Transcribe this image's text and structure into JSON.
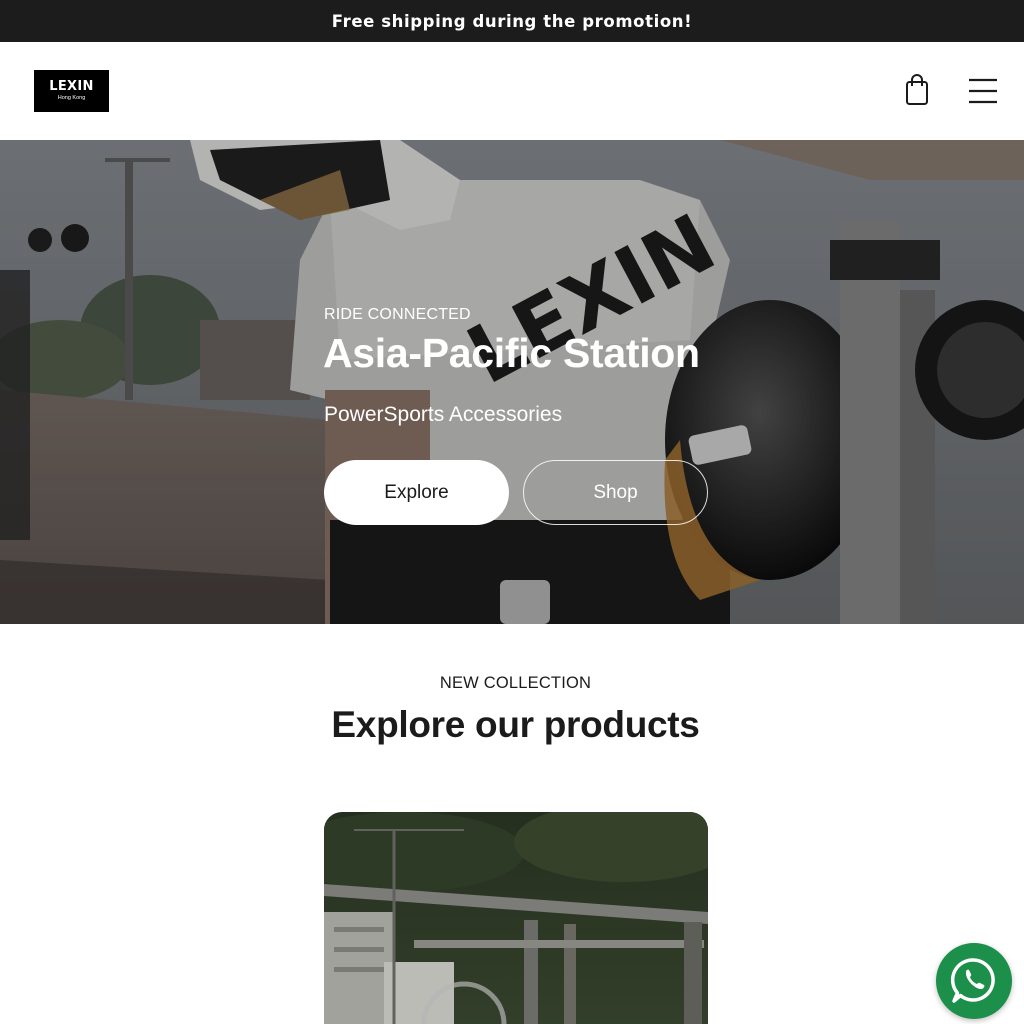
{
  "announcement": {
    "text": "Free shipping during the promotion!"
  },
  "header": {
    "logo": {
      "name": "LEXIN",
      "location": "Hong Kong"
    },
    "icons": {
      "cart": "shopping-bag-icon",
      "menu": "hamburger-menu-icon"
    }
  },
  "hero": {
    "eyebrow": "RIDE CONNECTED",
    "title": "Asia-Pacific Station",
    "subtitle": "PowerSports Accessories",
    "primary_button": "Explore",
    "secondary_button": "Shop",
    "shirt_print": "LEXIN"
  },
  "collection": {
    "eyebrow": "NEW COLLECTION",
    "title": "Explore our products"
  },
  "floating": {
    "whatsapp_icon": "whatsapp-icon"
  },
  "colors": {
    "announce_bg": "#1c1c1c",
    "whatsapp": "#1c8f4a",
    "text": "#1b1b1b"
  }
}
